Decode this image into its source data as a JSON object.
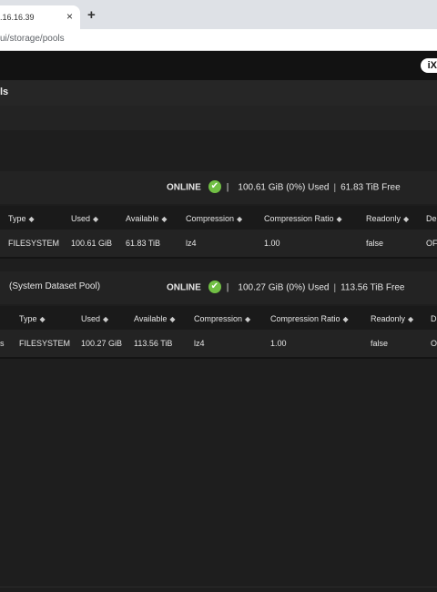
{
  "browser": {
    "tab_title": ".16.16.39",
    "close_glyph": "×",
    "new_tab_glyph": "+",
    "url": "ui/storage/pools"
  },
  "app": {
    "logo_text": "iX",
    "page_title": "ls"
  },
  "pools": [
    {
      "name": "",
      "status": "ONLINE",
      "check_glyph": "✔",
      "used_text": "100.61 GiB (0%) Used",
      "free_text": "61.83 TiB Free",
      "columns": [
        "Type",
        "Used",
        "Available",
        "Compression",
        "Compression Ratio",
        "Readonly",
        "De"
      ],
      "row": [
        "FILESYSTEM",
        "100.61 GiB",
        "61.83 TiB",
        "lz4",
        "1.00",
        "false",
        "OF"
      ]
    },
    {
      "name": "(System Dataset Pool)",
      "status": "ONLINE",
      "check_glyph": "✔",
      "used_text": "100.27 GiB (0%) Used",
      "free_text": "113.56 TiB Free",
      "columns": [
        "Type",
        "Used",
        "Available",
        "Compression",
        "Compression Ratio",
        "Readonly",
        "D"
      ],
      "row": [
        "s",
        "FILESYSTEM",
        "100.27 GiB",
        "113.56 TiB",
        "lz4",
        "1.00",
        "false",
        "O"
      ]
    }
  ],
  "colors": {
    "online_check": "#71bf44",
    "background": "#1e1e1e"
  }
}
